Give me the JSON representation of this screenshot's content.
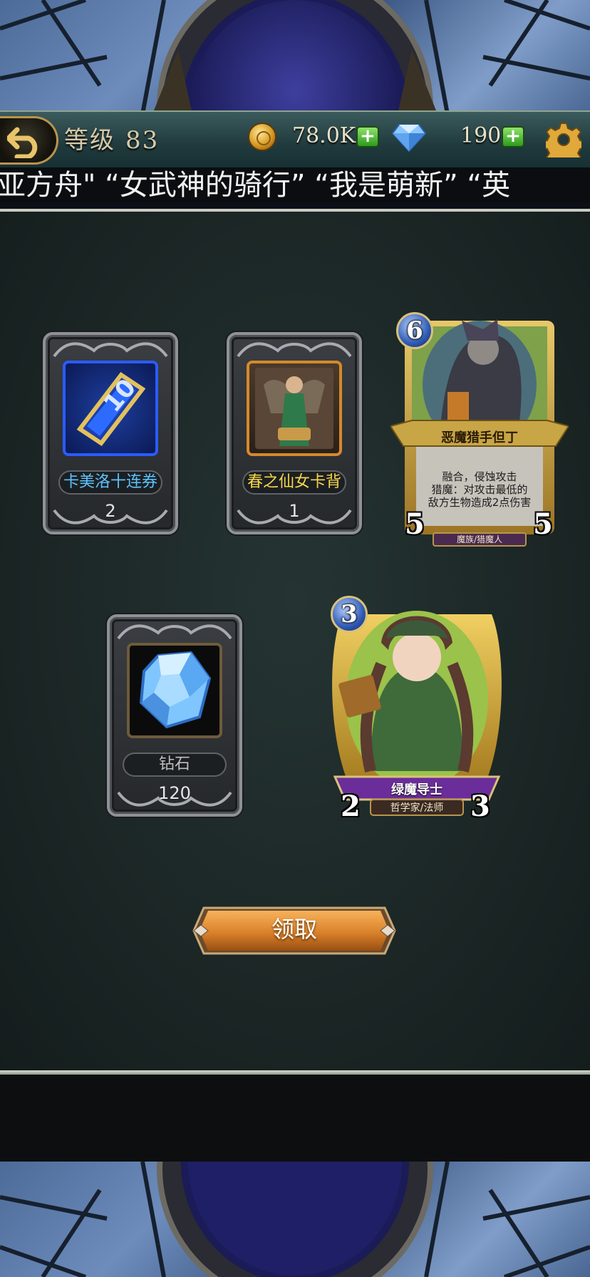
{
  "header": {
    "level_label": "等级",
    "level_value": "83",
    "coins": "78.0K",
    "gems": "190",
    "plus_symbol": "+"
  },
  "marquee": {
    "text": "亚方舟\" “女武神的骑行” “我是萌新” “英"
  },
  "rewards": {
    "items": [
      {
        "name": "卡美洛十连券",
        "count": "2",
        "name_color": "#5cc4ff",
        "icon": "ticket-icon"
      },
      {
        "name": "春之仙女卡背",
        "count": "1",
        "name_color": "#f5d64a",
        "icon": "card-back-icon"
      },
      {
        "name": "钻石",
        "count": "120",
        "name_color": "#bfbfbf",
        "icon": "diamond-icon"
      }
    ],
    "cards": [
      {
        "name": "恶魔猎手但丁",
        "cost": "6",
        "attack": "5",
        "health": "5",
        "text_line1": "融合，侵蚀攻击",
        "text_line2": "猎魔：对攻击最低的",
        "text_line3": "敌方生物造成2点伤害",
        "tribe": "魔族/猎魔人"
      },
      {
        "name": "绿魔导士",
        "cost": "3",
        "attack": "2",
        "health": "3",
        "tribe": "哲学家/法师"
      }
    ]
  },
  "claim_button": {
    "label": "领取"
  },
  "colors": {
    "accent_gold": "#c9a14a",
    "claim_orange": "#d9822b",
    "panel_bg": "#1f2b2a"
  }
}
